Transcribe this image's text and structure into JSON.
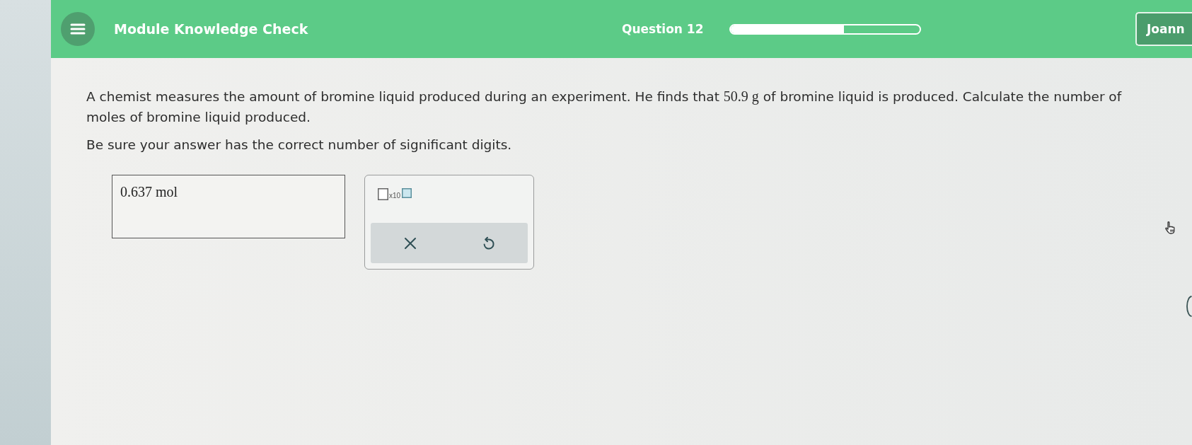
{
  "header": {
    "title": "Module Knowledge Check",
    "question_label": "Question 12",
    "progress": {
      "level": 0.6
    },
    "user_button": {
      "label": "Joann"
    }
  },
  "question": {
    "paragraphs": [
      {
        "parts": [
          {
            "kind": "text",
            "text": "A chemist measures the amount of bromine liquid produced during an experiment. He finds that "
          },
          {
            "kind": "math",
            "text": "50.9 g"
          },
          {
            "kind": "text",
            "text": " of bromine liquid is produced. Calculate the number of moles of bromine liquid produced."
          }
        ]
      },
      {
        "parts": [
          {
            "kind": "text",
            "text": "Be sure your answer has the correct number of significant digits."
          }
        ]
      }
    ]
  },
  "answer": {
    "value": "0.637 mol"
  },
  "tool_panel": {
    "notation_label": "x10"
  }
}
